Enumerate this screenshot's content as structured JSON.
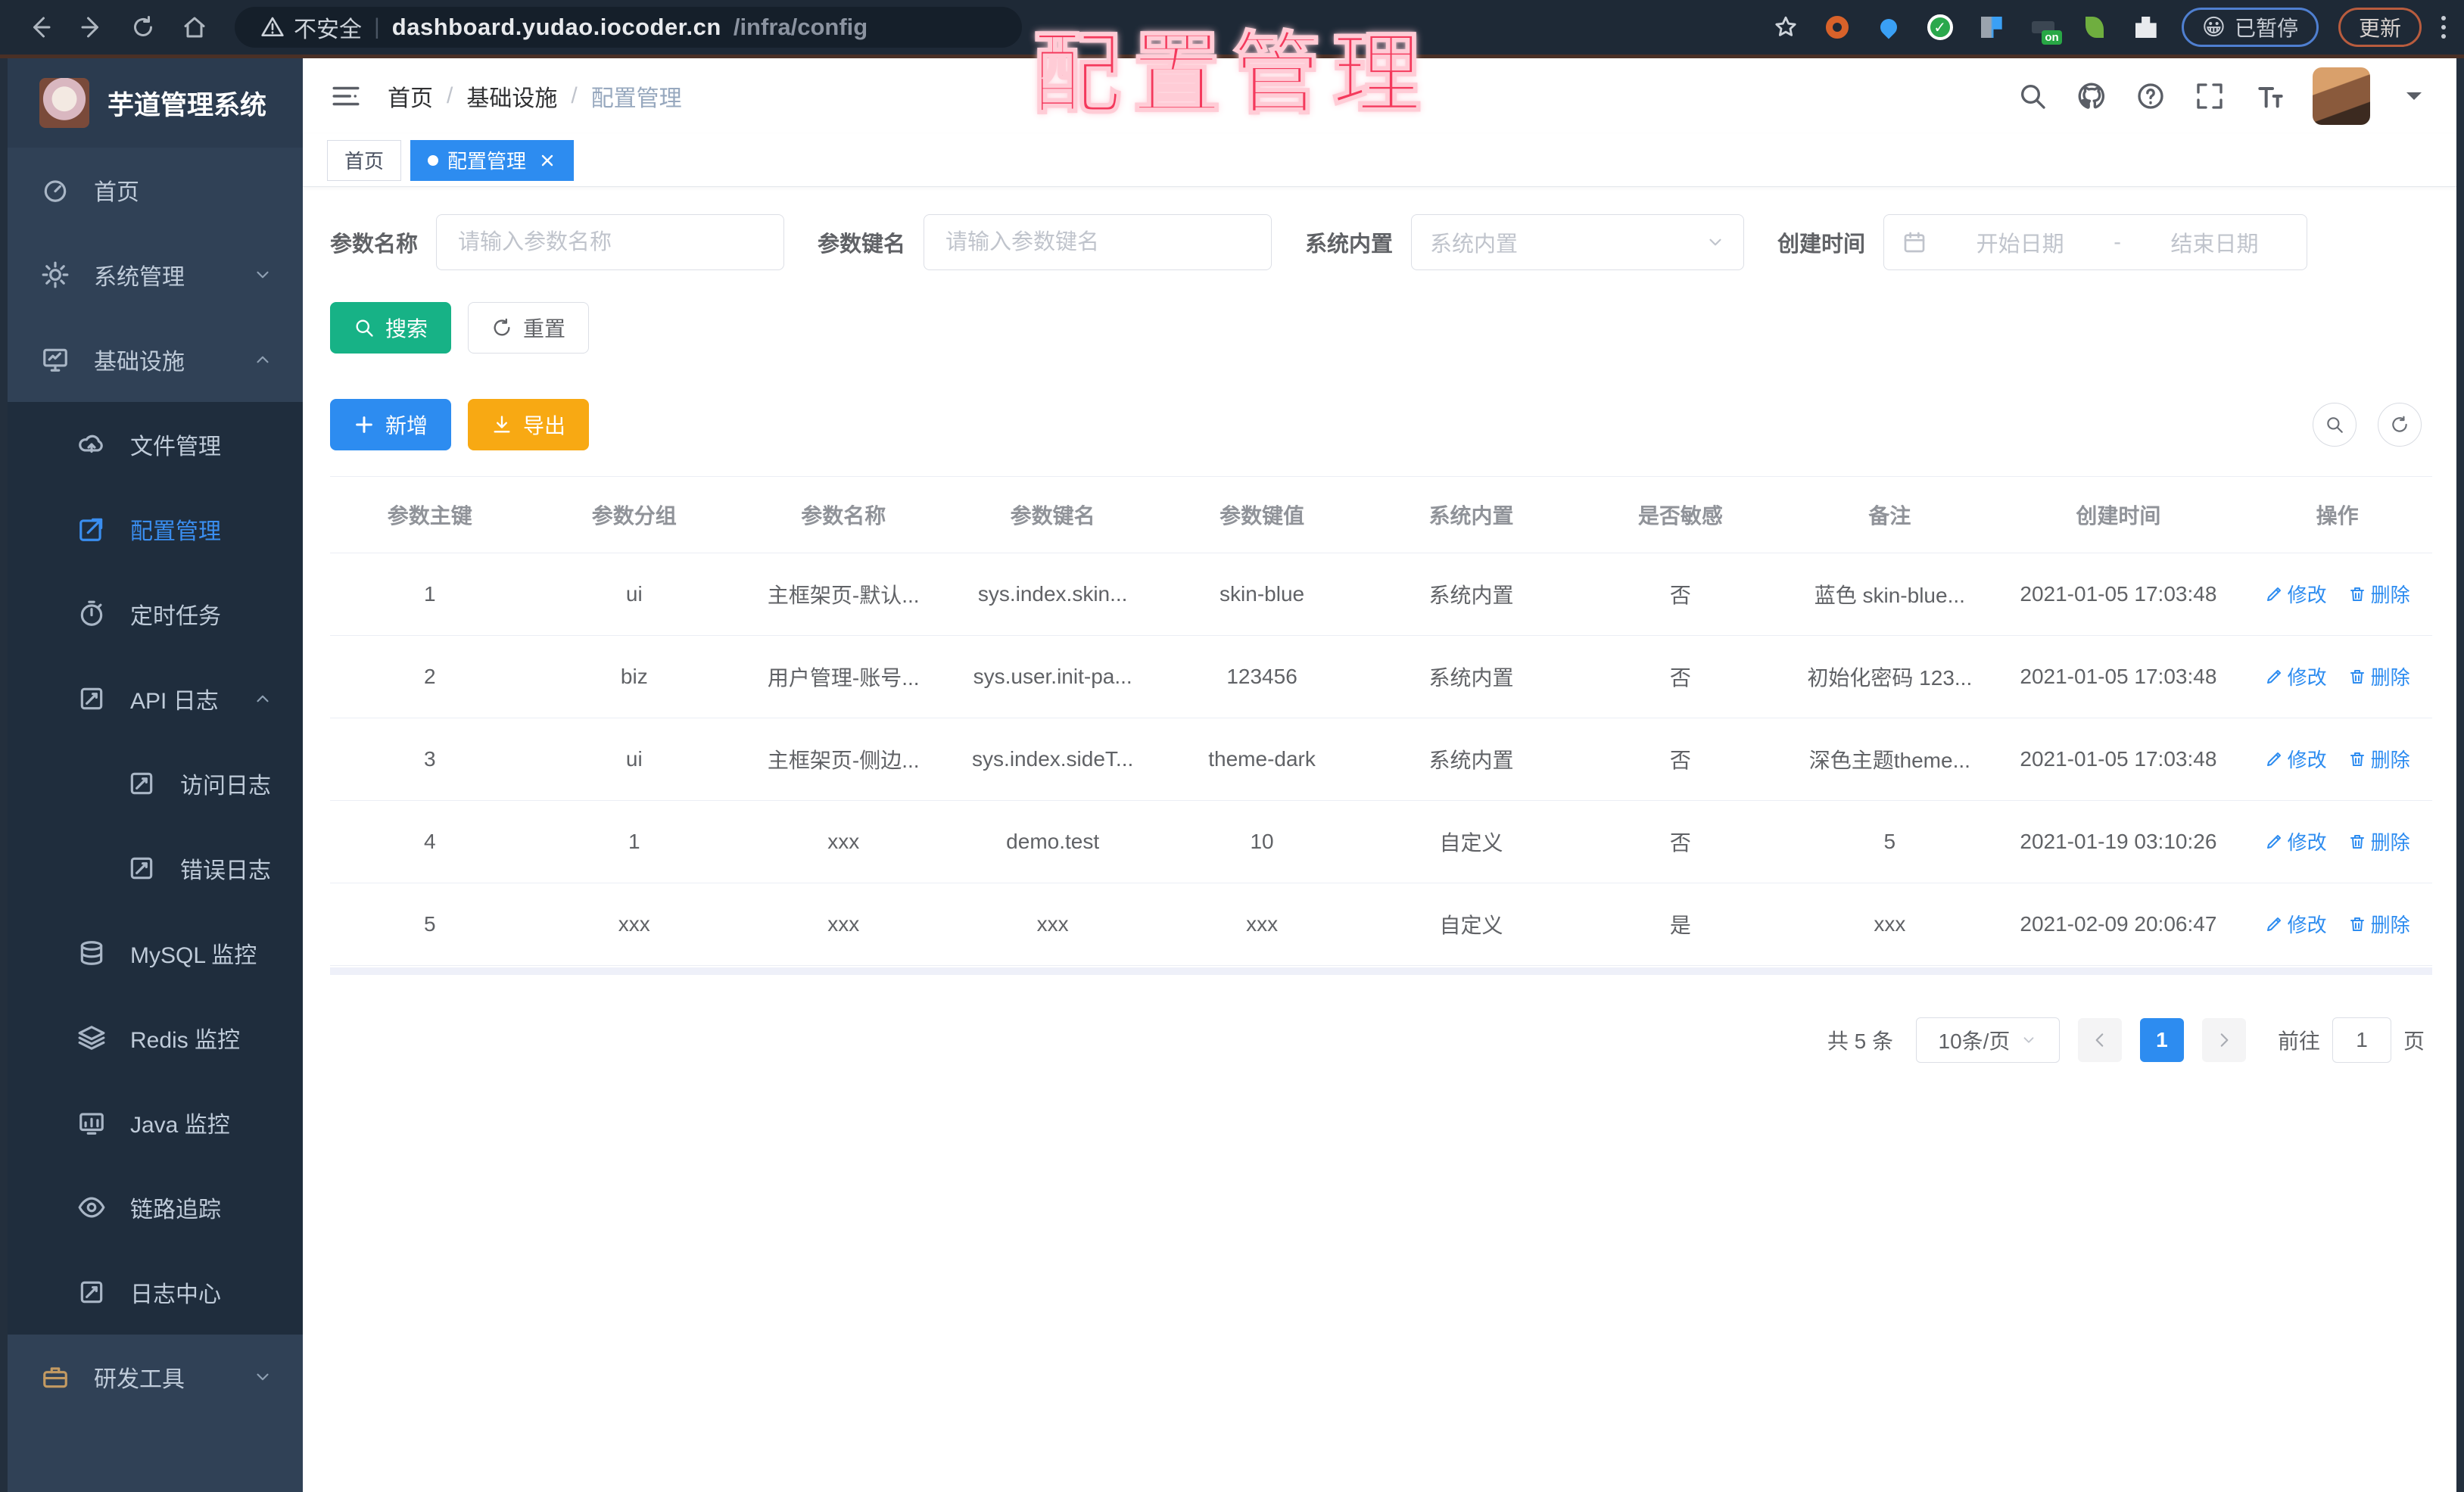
{
  "browser": {
    "security_label": "不安全",
    "url_host": "dashboard.yudao.iocoder.cn",
    "url_path": "/infra/config",
    "paused_label": "已暂停",
    "update_label": "更新"
  },
  "overlay": {
    "title": "配置管理"
  },
  "sidebar": {
    "logo_title": "芋道管理系统",
    "items": [
      {
        "label": "首页",
        "icon": "gauge",
        "level": 0
      },
      {
        "label": "系统管理",
        "icon": "gear",
        "level": 0,
        "chevron": "down"
      },
      {
        "label": "基础设施",
        "icon": "monitor",
        "level": 0,
        "chevron": "up"
      },
      {
        "label": "文件管理",
        "icon": "cloud",
        "level": 1
      },
      {
        "label": "配置管理",
        "icon": "edit",
        "level": 1,
        "active": true
      },
      {
        "label": "定时任务",
        "icon": "timer",
        "level": 1
      },
      {
        "label": "API 日志",
        "icon": "doclog",
        "level": 1,
        "chevron": "up"
      },
      {
        "label": "访问日志",
        "icon": "doclog",
        "level": 2
      },
      {
        "label": "错误日志",
        "icon": "doclog",
        "level": 2
      },
      {
        "label": "MySQL 监控",
        "icon": "db",
        "level": 1
      },
      {
        "label": "Redis 监控",
        "icon": "layers",
        "level": 1
      },
      {
        "label": "Java 监控",
        "icon": "java",
        "level": 1
      },
      {
        "label": "链路追踪",
        "icon": "eye",
        "level": 1
      },
      {
        "label": "日志中心",
        "icon": "doclog",
        "level": 1
      },
      {
        "label": "研发工具",
        "icon": "toolbox",
        "level": 0,
        "chevron": "down",
        "amber": true
      }
    ]
  },
  "header": {
    "breadcrumb": [
      "首页",
      "基础设施",
      "配置管理"
    ]
  },
  "tags": {
    "home_label": "首页",
    "active_label": "配置管理"
  },
  "filter": {
    "name_label": "参数名称",
    "name_placeholder": "请输入参数名称",
    "key_label": "参数键名",
    "key_placeholder": "请输入参数键名",
    "type_label": "系统内置",
    "type_placeholder": "系统内置",
    "date_label": "创建时间",
    "date_start_placeholder": "开始日期",
    "date_separator": "-",
    "date_end_placeholder": "结束日期",
    "search_label": "搜索",
    "reset_label": "重置"
  },
  "toolbar": {
    "add_label": "新增",
    "export_label": "导出"
  },
  "table": {
    "columns": [
      "参数主键",
      "参数分组",
      "参数名称",
      "参数键名",
      "参数键值",
      "系统内置",
      "是否敏感",
      "备注",
      "创建时间",
      "操作"
    ],
    "action_edit": "修改",
    "action_delete": "删除",
    "rows": [
      [
        "1",
        "ui",
        "主框架页-默认...",
        "sys.index.skin...",
        "skin-blue",
        "系统内置",
        "否",
        "蓝色 skin-blue...",
        "2021-01-05 17:03:48"
      ],
      [
        "2",
        "biz",
        "用户管理-账号...",
        "sys.user.init-pa...",
        "123456",
        "系统内置",
        "否",
        "初始化密码 123...",
        "2021-01-05 17:03:48"
      ],
      [
        "3",
        "ui",
        "主框架页-侧边...",
        "sys.index.sideT...",
        "theme-dark",
        "系统内置",
        "否",
        "深色主题theme...",
        "2021-01-05 17:03:48"
      ],
      [
        "4",
        "1",
        "xxx",
        "demo.test",
        "10",
        "自定义",
        "否",
        "5",
        "2021-01-19 03:10:26"
      ],
      [
        "5",
        "xxx",
        "xxx",
        "xxx",
        "xxx",
        "自定义",
        "是",
        "xxx",
        "2021-02-09 20:06:47"
      ]
    ]
  },
  "pagination": {
    "total": "共 5 条",
    "page_size": "10条/页",
    "current_page": "1",
    "goto_label": "前往",
    "goto_value": "1",
    "page_label": "页"
  },
  "colors": {
    "primary": "#2d8cf0",
    "success": "#17b286",
    "warning": "#f8a913",
    "overlay": "#f4395c"
  }
}
